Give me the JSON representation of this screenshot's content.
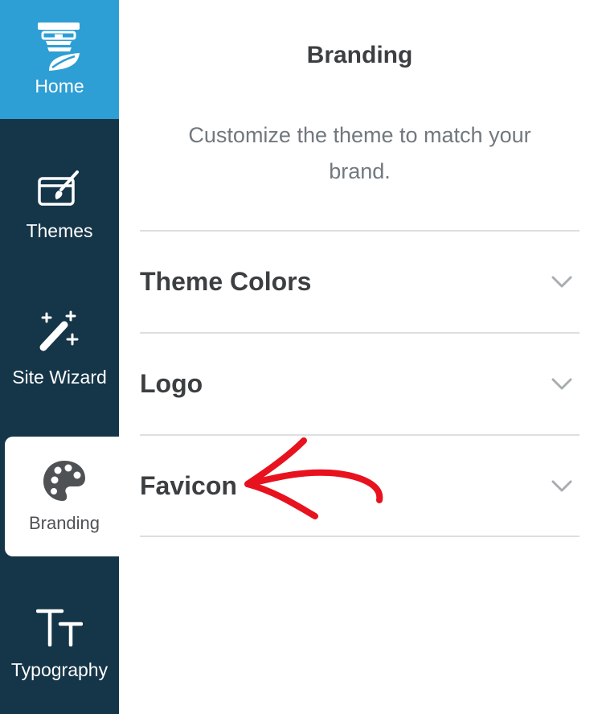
{
  "sidebar": {
    "items": [
      {
        "label": "Home",
        "icon": "lighthouse-logo-icon",
        "active_color": "#2e9fd4"
      },
      {
        "label": "Themes",
        "icon": "paintbrush-canvas-icon"
      },
      {
        "label": "Site Wizard",
        "icon": "magic-wand-icon"
      },
      {
        "label": "Branding",
        "icon": "palette-icon",
        "selected": true
      },
      {
        "label": "Typography",
        "icon": "text-size-icon"
      }
    ],
    "background": "#153548"
  },
  "panel": {
    "title": "Branding",
    "description": "Customize the theme to match your brand.",
    "sections": [
      {
        "label": "Theme Colors",
        "icon": "chevron-down-icon"
      },
      {
        "label": "Logo",
        "icon": "chevron-down-icon"
      },
      {
        "label": "Favicon",
        "icon": "chevron-down-icon"
      }
    ]
  },
  "annotation": {
    "icon": "red-arrow-icon",
    "color": "#e8121f"
  }
}
